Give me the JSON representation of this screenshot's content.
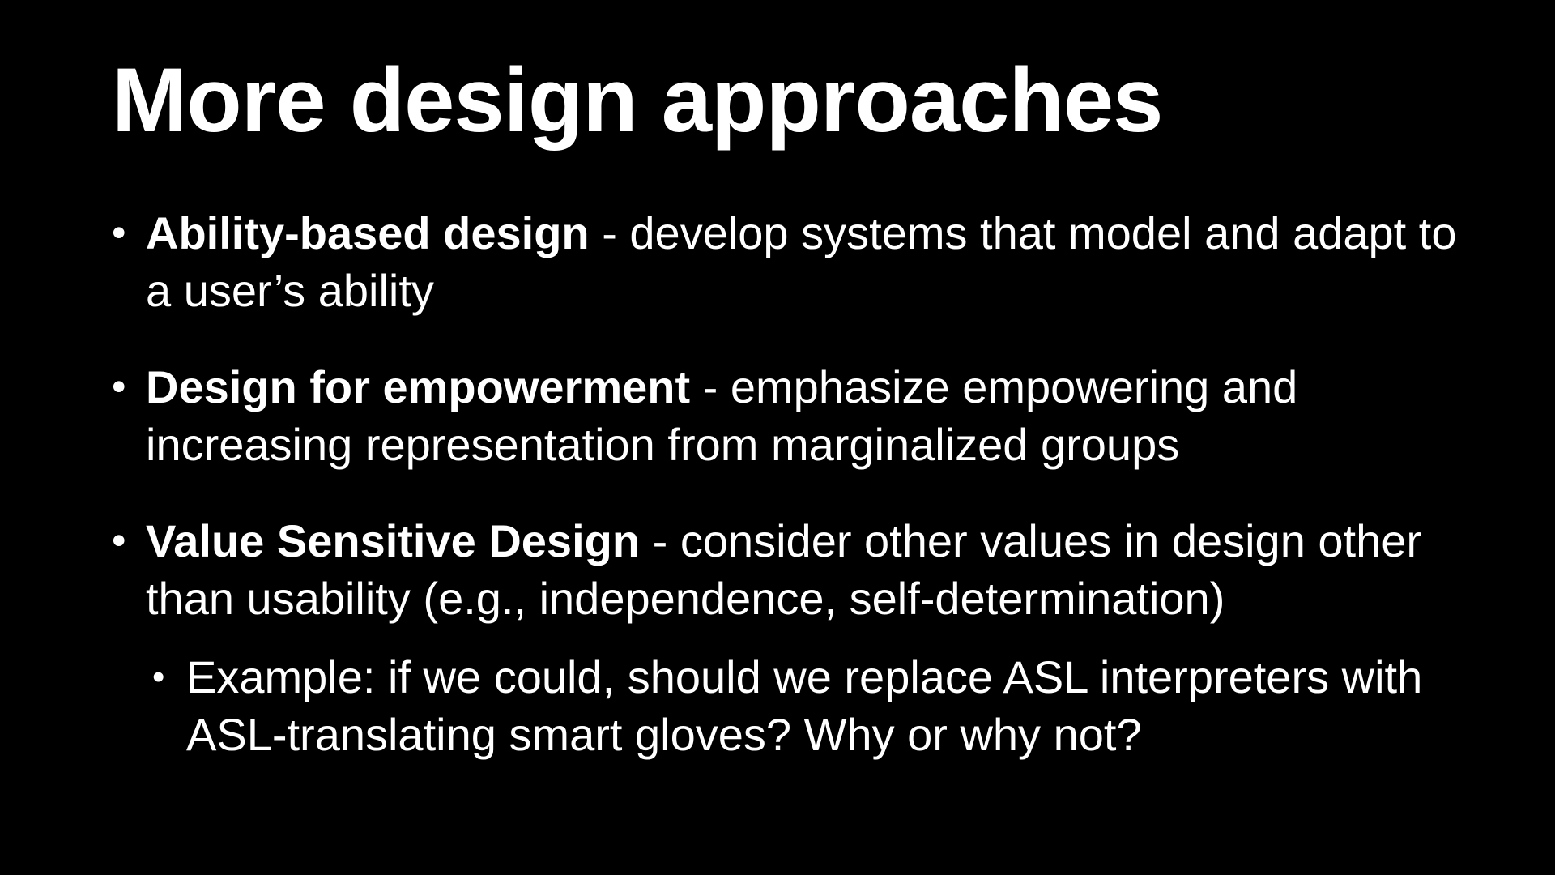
{
  "slide": {
    "title": "More design approaches",
    "bullets": [
      {
        "term": "Ability-based design",
        "text": " - develop systems that model and adapt to a user’s ability"
      },
      {
        "term": "Design for empowerment",
        "text": " - emphasize empowering and increasing representation from marginalized groups"
      },
      {
        "term": "Value Sensitive Design",
        "text": " - consider other values in design other than usability (e.g., independence, self-determination)"
      }
    ],
    "sub_bullet": {
      "text": "Example: if we could, should we replace ASL interpreters with ASL-translating smart gloves? Why or why not?"
    },
    "bullet_glyph": "•",
    "colors": {
      "background": "#000000",
      "text": "#ffffff"
    }
  }
}
